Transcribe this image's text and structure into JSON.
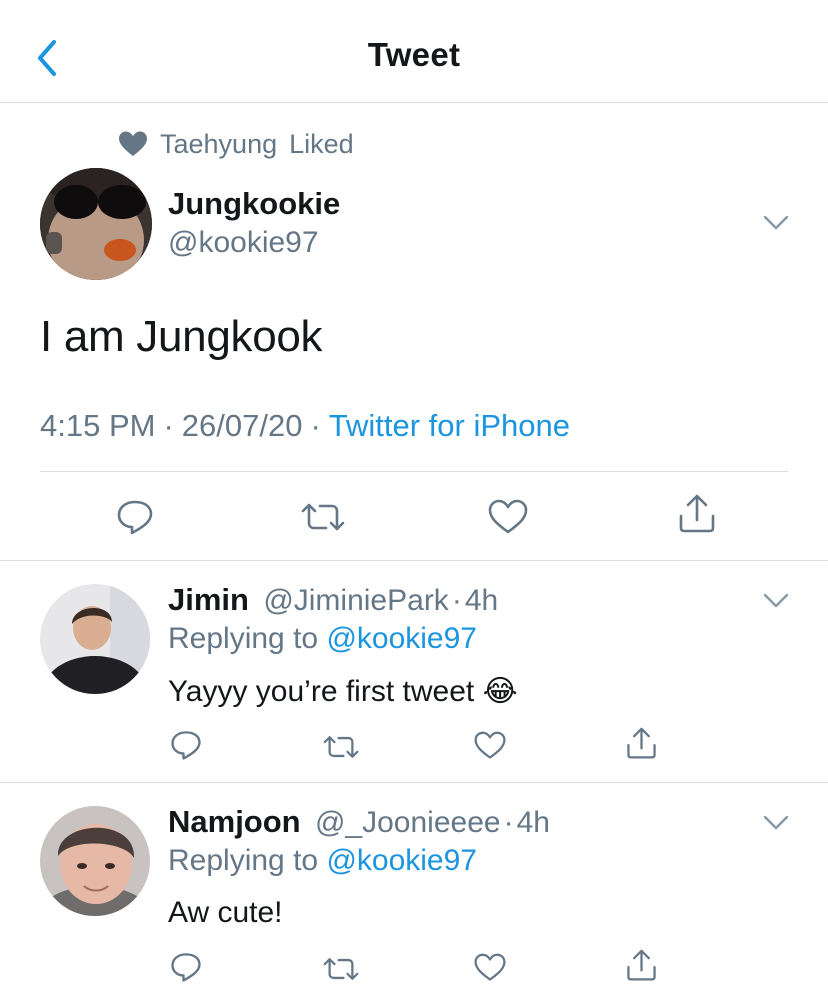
{
  "header": {
    "title": "Tweet",
    "back_icon": "chevron-left-icon"
  },
  "social_context": {
    "user": "Taehyung",
    "action": "Liked",
    "icon": "heart-filled-icon"
  },
  "main_tweet": {
    "display_name": "Jungkookie",
    "handle": "@kookie97",
    "text": "I am Jungkook",
    "time": "4:15 PM",
    "separator": "·",
    "date": "26/07/20",
    "source": "Twitter for iPhone"
  },
  "replies": [
    {
      "display_name": "Jimin",
      "handle": "@JiminiePark",
      "time_sep": "·",
      "age": "4h",
      "replying_prefix": "Replying to",
      "replying_to": "@kookie97",
      "text": "Yayyy you’re first tweet",
      "emoji": "😂"
    },
    {
      "display_name": "Namjoon",
      "handle": "@_Joonieeee",
      "time_sep": "·",
      "age": "4h",
      "replying_prefix": "Replying to",
      "replying_to": "@kookie97",
      "text": "Aw cute!"
    }
  ],
  "colors": {
    "accent": "#1b95e0",
    "secondary_text": "#657786",
    "primary_text": "#14171a",
    "divider": "#d9dee2"
  }
}
